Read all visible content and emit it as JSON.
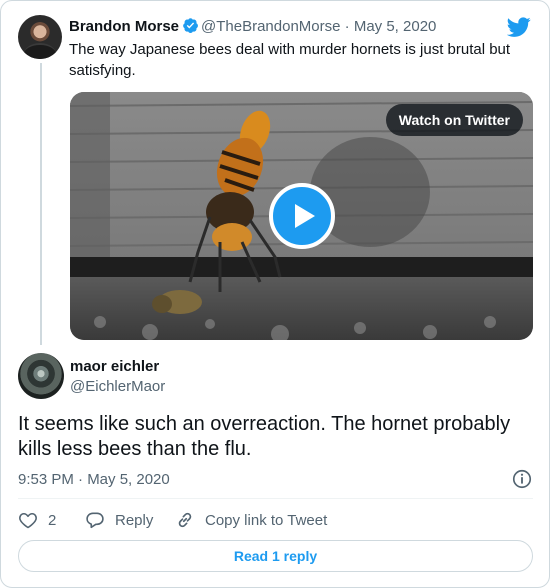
{
  "parent": {
    "name": "Brandon Morse",
    "handle": "@TheBrandonMorse",
    "separator": "·",
    "date": "May 5, 2020",
    "text": "The way Japanese bees deal with murder hornets is just brutal but satisfying.",
    "avatar_icon": "profile-photo"
  },
  "media": {
    "watch_label": "Watch on Twitter",
    "play_icon": "play-icon",
    "accent": "#1d9bf0"
  },
  "reply": {
    "name": "maor eichler",
    "handle": "@EichlerMaor",
    "text": "It seems like such an overreaction. The hornet probably kills less bees than the flu.",
    "time": "9:53 PM · May 5, 2020"
  },
  "actions": {
    "like_count": "2",
    "reply_label": "Reply",
    "copy_label": "Copy link to Tweet"
  },
  "footer": {
    "read_replies_label": "Read 1 reply"
  },
  "colors": {
    "brand": "#1d9bf0",
    "secondary_text": "#536471",
    "border": "#cfd9de"
  }
}
